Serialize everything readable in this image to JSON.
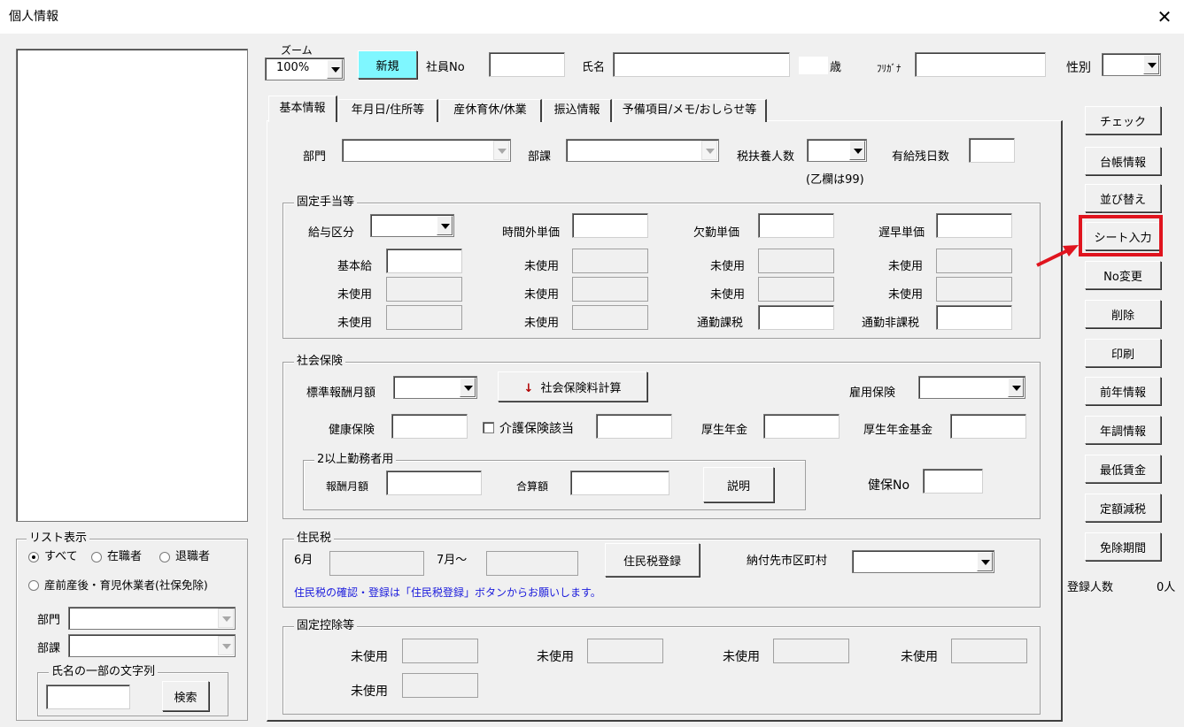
{
  "window": {
    "title": "個人情報",
    "close_icon": "close-icon"
  },
  "header": {
    "zoom_label": "ズーム",
    "zoom_value": "100%",
    "new_button": "新規",
    "employee_no_label": "社員No",
    "name_label": "氏名",
    "age_unit": "歳",
    "furigana_label": "ﾌﾘｶﾞﾅ",
    "gender_label": "性別"
  },
  "tabs": [
    {
      "label": "基本情報"
    },
    {
      "label": "年月日/住所等"
    },
    {
      "label": "産休育休/休業"
    },
    {
      "label": "振込情報"
    },
    {
      "label": "予備項目/メモ/おしらせ等"
    }
  ],
  "basic": {
    "dept_label": "部門",
    "section_label": "部課",
    "dependents_label": "税扶養人数",
    "dependents_note": "(乙欄は99)",
    "paid_leave_label": "有給残日数"
  },
  "fixed_allowance": {
    "title": "固定手当等",
    "pay_type_label": "給与区分",
    "overtime_rate_label": "時間外単価",
    "absence_rate_label": "欠勤単価",
    "late_rate_label": "遅早単価",
    "base_pay_label": "基本給",
    "unused_label": "未使用",
    "commute_taxable_label": "通勤課税",
    "commute_nontaxable_label": "通勤非課税"
  },
  "social_insurance": {
    "title": "社会保険",
    "standard_monthly_label": "標準報酬月額",
    "calc_button": "社会保険料計算",
    "employment_ins_label": "雇用保険",
    "health_ins_label": "健康保険",
    "care_ins_label": "介護保険該当",
    "pension_label": "厚生年金",
    "pension_fund_label": "厚生年金基金",
    "multi_employ_title": "2以上勤務者用",
    "monthly_pay_label": "報酬月額",
    "total_label": "合算額",
    "explain_button": "説明",
    "health_no_label": "健保No"
  },
  "resident_tax": {
    "title": "住民税",
    "june_label": "6月",
    "july_label": "7月～",
    "register_button": "住民税登録",
    "municipality_label": "納付先市区町村",
    "note": "住民税の確認・登録は「住民税登録」ボタンからお願いします。"
  },
  "fixed_deduction": {
    "title": "固定控除等",
    "unused_label": "未使用"
  },
  "list_display": {
    "title": "リスト表示",
    "all": "すべて",
    "employed": "在職者",
    "retired": "退職者",
    "leave": "産前産後・育児休業者(社保免除)",
    "dept_label": "部門",
    "section_label": "部課",
    "name_search_title": "氏名の一部の文字列",
    "search_button": "検索"
  },
  "side_buttons": [
    {
      "label": "チェック"
    },
    {
      "label": "台帳情報"
    },
    {
      "label": "並び替え"
    },
    {
      "label": "シート入力"
    },
    {
      "label": "No変更"
    },
    {
      "label": "削除"
    },
    {
      "label": "印刷"
    },
    {
      "label": "前年情報"
    },
    {
      "label": "年調情報"
    },
    {
      "label": "最低賃金"
    },
    {
      "label": "定額減税"
    },
    {
      "label": "免除期間"
    }
  ],
  "registered": {
    "label": "登録人数",
    "value": "0人"
  },
  "colors": {
    "new_button_bg": "#7ff7ff",
    "highlight": "#e0141e",
    "note_text": "#1a1adc"
  }
}
